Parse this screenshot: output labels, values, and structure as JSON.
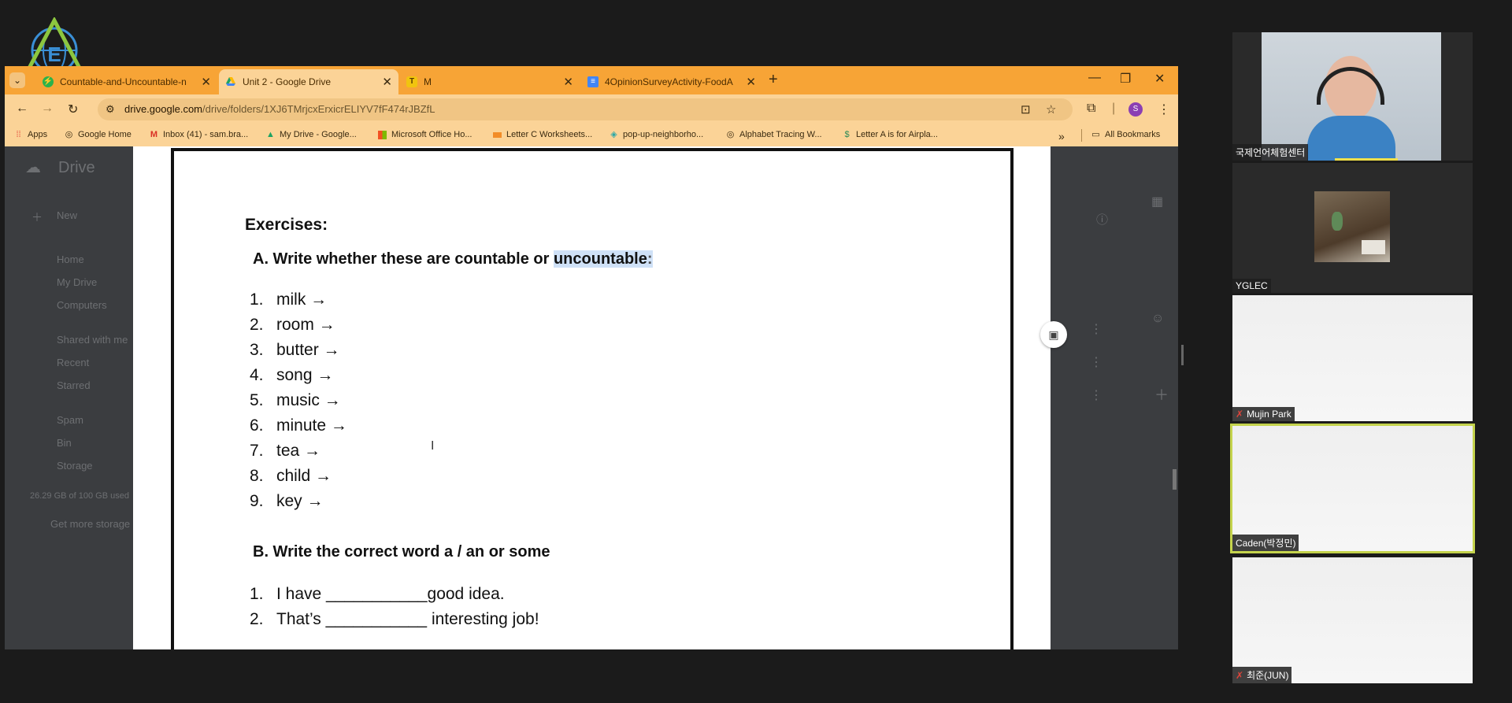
{
  "browser": {
    "tabs": [
      {
        "label": "Countable-and-Uncountable-n",
        "favicon": "green-bolt-icon",
        "active": false
      },
      {
        "label": "Unit 2 - Google Drive",
        "favicon": "google-drive-icon",
        "active": true
      },
      {
        "label": "M",
        "favicon": "yellow-t-icon",
        "active": false
      },
      {
        "label": "4OpinionSurveyActivity-FoodA",
        "favicon": "google-docs-icon",
        "active": false
      }
    ],
    "url_host": "drive.google.com",
    "url_path": "/drive/folders/1XJ6TMrjcxErxicrELIYV7fF474rJBZfL",
    "bookmarks": [
      {
        "label": "Apps",
        "icon": "apps-grid-icon"
      },
      {
        "label": "Google Home",
        "icon": "globe-icon"
      },
      {
        "label": "Inbox (41) - sam.bra...",
        "icon": "gmail-icon"
      },
      {
        "label": "My Drive - Google...",
        "icon": "google-drive-icon"
      },
      {
        "label": "Microsoft Office Ho...",
        "icon": "microsoft-icon"
      },
      {
        "label": "Letter C Worksheets...",
        "icon": "orange-bookmark-icon"
      },
      {
        "label": "pop-up-neighborho...",
        "icon": "tag-icon"
      },
      {
        "label": "Alphabet Tracing W...",
        "icon": "globe-icon"
      },
      {
        "label": "Letter A is for Airpla...",
        "icon": "money-icon"
      }
    ],
    "all_bookmarks": "All Bookmarks",
    "profile_initial": "S"
  },
  "drive_bg": {
    "title": "Drive",
    "new": "New",
    "items": [
      "Home",
      "My Drive",
      "Computers",
      "Shared with me",
      "Recent",
      "Starred",
      "Spam",
      "Bin",
      "Storage"
    ],
    "storage": "26.29 GB of 100 GB used",
    "get_more": "Get more storage"
  },
  "document": {
    "heading": "Exercises:",
    "sectionA_prefix": "A.  Write whether these are countable or ",
    "sectionA_highlight": "uncountable",
    "sectionA_suffix": ":",
    "listA": [
      {
        "n": "1.",
        "t": "milk →"
      },
      {
        "n": "2.",
        "t": "room →"
      },
      {
        "n": "3.",
        "t": "butter →"
      },
      {
        "n": "4.",
        "t": "song →"
      },
      {
        "n": "5.",
        "t": "music →"
      },
      {
        "n": "6.",
        "t": "minute →"
      },
      {
        "n": "7.",
        "t": "tea →"
      },
      {
        "n": "8.",
        "t": "child →"
      },
      {
        "n": "9.",
        "t": "key →"
      }
    ],
    "sectionB": "B.  Write the correct word a / an or some",
    "listB": [
      {
        "n": "1.",
        "t": "I have ___________good idea."
      },
      {
        "n": "2.",
        "t": "That’s ___________ interesting job!"
      }
    ]
  },
  "participants": [
    {
      "name": "국제언어체험센터",
      "muted": false
    },
    {
      "name": "YGLEC",
      "muted": false
    },
    {
      "name": "Mujin Park",
      "muted": true
    },
    {
      "name": "Caden(박정민)",
      "muted": false
    },
    {
      "name": "최준(JUN)",
      "muted": true
    }
  ]
}
